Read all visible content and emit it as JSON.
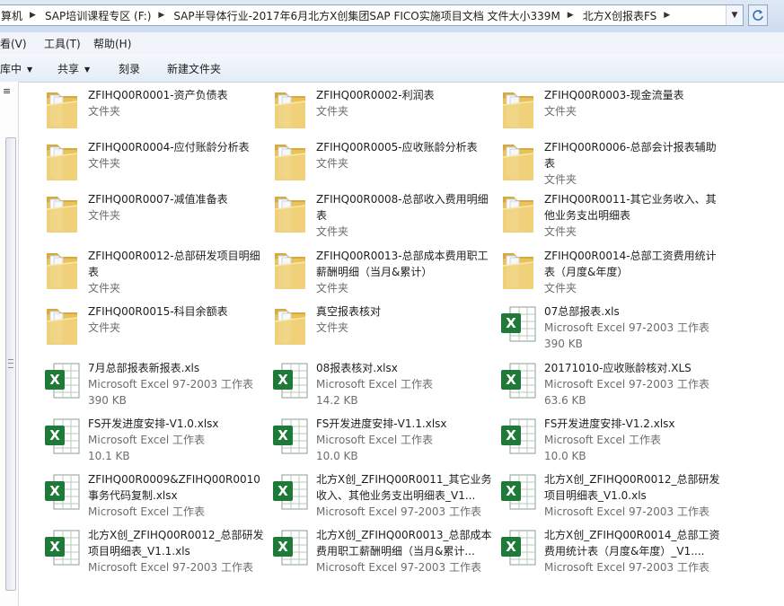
{
  "address": {
    "crumbs": [
      "算机",
      "SAP培训课程专区 (F:)",
      "SAP半导体行业-2017年6月北方X创集团SAP FICO实施项目文档 文件大小339M",
      "北方X创报表FS"
    ]
  },
  "menu": {
    "view": "看(V)",
    "tools": "工具(T)",
    "help": "帮助(H)"
  },
  "toolbar": {
    "library": "库中",
    "share": "共享",
    "burn": "刻录",
    "new_folder": "新建文件夹"
  },
  "left_pane": {
    "scroll_up_glyph": "≡"
  },
  "icons": {
    "folder": "folder-icon",
    "excel": "excel-icon",
    "refresh": "refresh-icon"
  },
  "colors": {
    "folder": "#e9c35e",
    "excel_green": "#1f7a3a",
    "accent": "#3a6ea5"
  },
  "files": [
    {
      "kind": "folder",
      "name": "ZFIHQ00R0001-资产负债表",
      "type": "文件夹",
      "size": ""
    },
    {
      "kind": "folder",
      "name": "ZFIHQ00R0002-利润表",
      "type": "文件夹",
      "size": ""
    },
    {
      "kind": "folder",
      "name": "ZFIHQ00R0003-现金流量表",
      "type": "文件夹",
      "size": ""
    },
    {
      "kind": "folder",
      "name": "ZFIHQ00R0004-应付账龄分析表",
      "type": "文件夹",
      "size": ""
    },
    {
      "kind": "folder",
      "name": "ZFIHQ00R0005-应收账龄分析表",
      "type": "文件夹",
      "size": ""
    },
    {
      "kind": "folder",
      "name": "ZFIHQ00R0006-总部会计报表辅助表",
      "type": "文件夹",
      "size": ""
    },
    {
      "kind": "folder",
      "name": "ZFIHQ00R0007-减值准备表",
      "type": "文件夹",
      "size": ""
    },
    {
      "kind": "folder",
      "name": "ZFIHQ00R0008-总部收入费用明细表",
      "type": "文件夹",
      "size": ""
    },
    {
      "kind": "folder",
      "name": "ZFIHQ00R0011-其它业务收入、其他业务支出明细表",
      "type": "文件夹",
      "size": ""
    },
    {
      "kind": "folder",
      "name": "ZFIHQ00R0012-总部研发项目明细表",
      "type": "文件夹",
      "size": ""
    },
    {
      "kind": "folder",
      "name": "ZFIHQ00R0013-总部成本费用职工薪酬明细（当月&累计）",
      "type": "文件夹",
      "size": ""
    },
    {
      "kind": "folder",
      "name": "ZFIHQ00R0014-总部工资费用统计表（月度&年度）",
      "type": "文件夹",
      "size": ""
    },
    {
      "kind": "folder",
      "name": "ZFIHQ00R0015-科目余额表",
      "type": "文件夹",
      "size": ""
    },
    {
      "kind": "folder",
      "name": "真空报表核对",
      "type": "文件夹",
      "size": ""
    },
    {
      "kind": "excel",
      "name": "07总部报表.xls",
      "type": "Microsoft Excel 97-2003 工作表",
      "size": "390 KB"
    },
    {
      "kind": "excel",
      "name": "7月总部报表新报表.xls",
      "type": "Microsoft Excel 97-2003 工作表",
      "size": "390 KB"
    },
    {
      "kind": "excel",
      "name": "08报表核对.xlsx",
      "type": "Microsoft Excel 工作表",
      "size": "14.2 KB"
    },
    {
      "kind": "excel",
      "name": "20171010-应收账龄核对.XLS",
      "type": "Microsoft Excel 97-2003 工作表",
      "size": "63.6 KB"
    },
    {
      "kind": "excel",
      "name": "FS开发进度安排-V1.0.xlsx",
      "type": "Microsoft Excel 工作表",
      "size": "10.1 KB"
    },
    {
      "kind": "excel",
      "name": "FS开发进度安排-V1.1.xlsx",
      "type": "Microsoft Excel 工作表",
      "size": "10.0 KB"
    },
    {
      "kind": "excel",
      "name": "FS开发进度安排-V1.2.xlsx",
      "type": "Microsoft Excel 工作表",
      "size": "10.0 KB"
    },
    {
      "kind": "excel",
      "name": "ZFIHQ00R0009&ZFIHQ00R0010事务代码复制.xlsx",
      "type": "Microsoft Excel 工作表",
      "size": ""
    },
    {
      "kind": "excel",
      "name": "北方X创_ZFIHQ00R0011_其它业务收入、其他业务支出明细表_V1...",
      "type": "Microsoft Excel 97-2003 工作表",
      "size": ""
    },
    {
      "kind": "excel",
      "name": "北方X创_ZFIHQ00R0012_总部研发项目明细表_V1.0.xls",
      "type": "Microsoft Excel 97-2003 工作表",
      "size": ""
    },
    {
      "kind": "excel",
      "name": "北方X创_ZFIHQ00R0012_总部研发项目明细表_V1.1.xls",
      "type": "Microsoft Excel 97-2003 工作表",
      "size": ""
    },
    {
      "kind": "excel",
      "name": "北方X创_ZFIHQ00R0013_总部成本费用职工薪酬明细（当月&累计...",
      "type": "Microsoft Excel 97-2003 工作表",
      "size": ""
    },
    {
      "kind": "excel",
      "name": "北方X创_ZFIHQ00R0014_总部工资费用统计表（月度&年度）_V1....",
      "type": "Microsoft Excel 97-2003 工作表",
      "size": ""
    }
  ]
}
